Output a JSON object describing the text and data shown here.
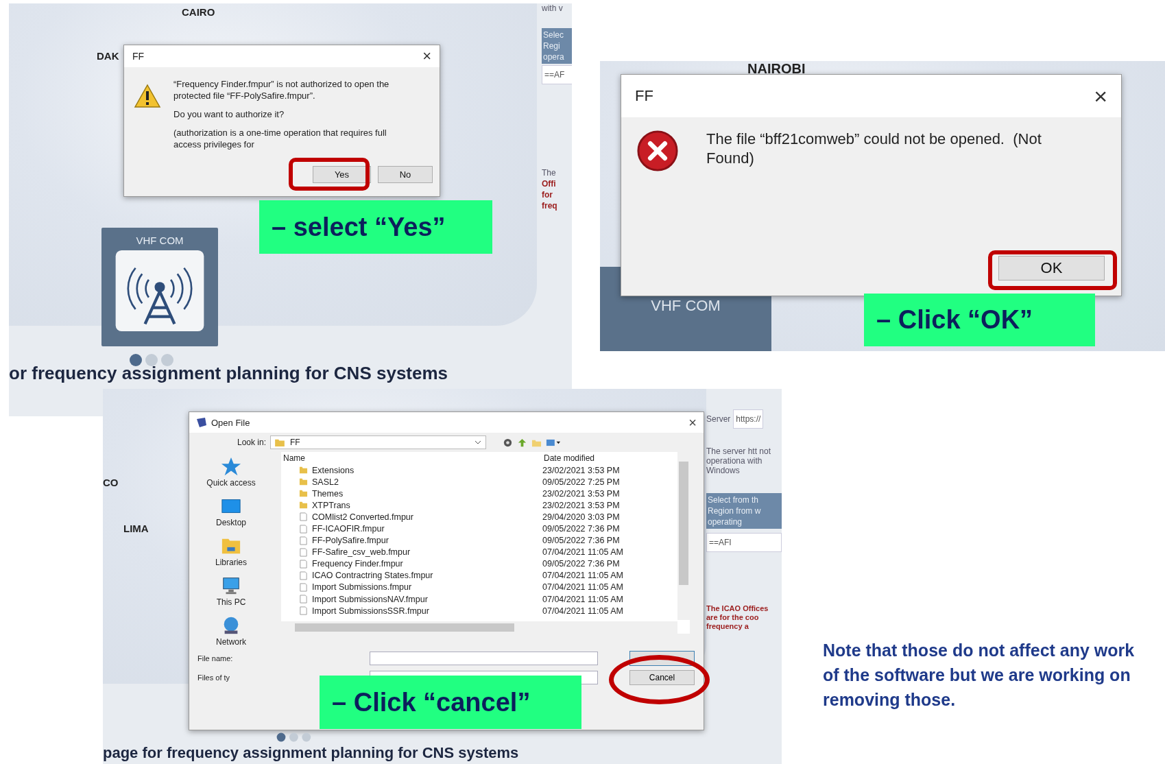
{
  "authorize_panel": {
    "map_labels": [
      "CAIRO",
      "DAK"
    ],
    "tile_label": "VHF COM",
    "headline": "or frequency assignment planning for CNS systems",
    "side_texts": [
      "with v",
      "Selec Regi opera",
      "==AF",
      "The",
      "Offi",
      "for",
      "freq"
    ],
    "dialog": {
      "title": "FF",
      "close": "×",
      "message": "“Frequency Finder.fmpur” is not authorized to open the protected file “FF-PolySafire.fmpur”.",
      "question": "Do you want to authorize it?",
      "note": "(authorization is a one-time operation that requires full access privileges for",
      "buttons": [
        "Yes",
        "No"
      ]
    },
    "callout": "– select “Yes”"
  },
  "error_panel": {
    "map_label": "NAIROBI",
    "tile_label": "VHF COM",
    "dialog": {
      "title": "FF",
      "close": "×",
      "message": "The file “bff21comweb” could not be opened.  (Not Found)",
      "button": "OK"
    },
    "callout": "– Click “OK”"
  },
  "open_file_panel": {
    "map_labels": [
      "CO",
      "LIMA"
    ],
    "headline": "page for frequency assignment planning for CNS systems",
    "side": {
      "server_label": "Server",
      "server_value": "https://",
      "info": "The server htt not operationa with Windows",
      "select_label": "Select from th Region from w operating",
      "select_value": "==AFI",
      "icao": "The ICAO Offices are for the coo frequency a"
    },
    "dialog": {
      "title": "Open File",
      "close": "×",
      "look_in_label": "Look in:",
      "look_in_value": "FF",
      "places": [
        {
          "label": "Quick access",
          "kind": "star"
        },
        {
          "label": "Desktop",
          "kind": "desktop"
        },
        {
          "label": "Libraries",
          "kind": "libraries"
        },
        {
          "label": "This PC",
          "kind": "pc"
        },
        {
          "label": "Network",
          "kind": "network"
        }
      ],
      "columns": [
        "Name",
        "Date modified"
      ],
      "rows": [
        {
          "name": "Extensions",
          "date": "23/02/2021 3:53 PM",
          "kind": "folder"
        },
        {
          "name": "SASL2",
          "date": "09/05/2022 7:25 PM",
          "kind": "folder"
        },
        {
          "name": "Themes",
          "date": "23/02/2021 3:53 PM",
          "kind": "folder"
        },
        {
          "name": "XTPTrans",
          "date": "23/02/2021 3:53 PM",
          "kind": "folder"
        },
        {
          "name": "COMlist2 Converted.fmpur",
          "date": "29/04/2020 3:03 PM",
          "kind": "file"
        },
        {
          "name": "FF-ICAOFIR.fmpur",
          "date": "09/05/2022 7:36 PM",
          "kind": "file"
        },
        {
          "name": "FF-PolySafire.fmpur",
          "date": "09/05/2022 7:36 PM",
          "kind": "file"
        },
        {
          "name": "FF-Safire_csv_web.fmpur",
          "date": "07/04/2021 11:05 AM",
          "kind": "file"
        },
        {
          "name": "Frequency Finder.fmpur",
          "date": "09/05/2022 7:36 PM",
          "kind": "file"
        },
        {
          "name": "ICAO Contractring States.fmpur",
          "date": "07/04/2021 11:05 AM",
          "kind": "file"
        },
        {
          "name": "Import Submissions.fmpur",
          "date": "07/04/2021 11:05 AM",
          "kind": "file"
        },
        {
          "name": "Import SubmissionsNAV.fmpur",
          "date": "07/04/2021 11:05 AM",
          "kind": "file"
        },
        {
          "name": "Import SubmissionsSSR.fmpur",
          "date": "07/04/2021 11:05 AM",
          "kind": "file"
        }
      ],
      "file_name_label": "File name:",
      "file_type_label": "Files of ty",
      "cancel": "Cancel"
    },
    "callout": "– Click “cancel”"
  },
  "note": "Note that those do not affect any work of the software but we are working on removing those."
}
